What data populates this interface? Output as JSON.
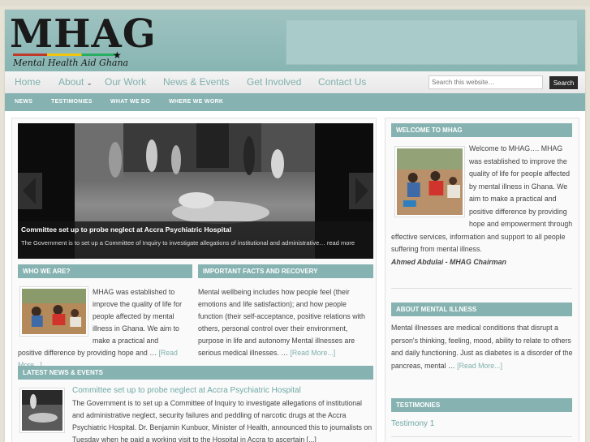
{
  "brand": {
    "name": "MHAG",
    "tagline": "Mental Health Aid Ghana",
    "stripe_colors": [
      "#c0392b",
      "#f1c40f",
      "#27ae60"
    ]
  },
  "colors": {
    "accent": "#86b3b1",
    "link": "#7fb0ad",
    "header": "#9fc3c1"
  },
  "nav": {
    "items": [
      {
        "label": "Home"
      },
      {
        "label": "About",
        "dropdown": true
      },
      {
        "label": "Our Work"
      },
      {
        "label": "News & Events"
      },
      {
        "label": "Get Involved"
      },
      {
        "label": "Contact Us"
      }
    ],
    "chevron": "⌄"
  },
  "search": {
    "placeholder": "Search this website…",
    "button_label": "Search"
  },
  "subnav": {
    "items": [
      "NEWS",
      "TESTIMONIES",
      "WHAT WE DO",
      "WHERE WE WORK"
    ]
  },
  "slider": {
    "title": "Committee set up to probe neglect at Accra Psychiatric Hospital",
    "description": "The Government is to set up a Committee of Inquiry to investigate allegations of institutional and administrative… read more",
    "prev_icon": "chevron-left-icon",
    "next_icon": "chevron-right-icon"
  },
  "who_we_are": {
    "heading": "WHO WE ARE?",
    "text": "MHAG was established to improve the quality of life for people affected by mental illness in Ghana. We aim to make a practical and positive difference by providing hope and … ",
    "read_more": "[Read More...]"
  },
  "facts": {
    "heading": "IMPORTANT FACTS AND RECOVERY",
    "text": "Mental wellbeing includes how people feel (their emotions and life satisfaction); and how people function (their self-acceptance, positive relations with others, personal control over their environment, purpose in life and autonomy Mental illnesses are serious medical illnesses. … ",
    "read_more": "[Read More...]"
  },
  "latest_news": {
    "heading": "LATEST NEWS & EVENTS",
    "title": "Committee set up to probe neglect at Accra Psychiatric Hospital",
    "text": "The Government is to set up a Committee of Inquiry to investigate allegations of institutional and administrative neglect, security failures and peddling of narcotic drugs at the Accra Psychiatric Hospital. Dr. Benjamin Kunbuor, Minister of Health, announced this to journalists on Tuesday when he paid a working visit to the Hospital in Accra to ascertain [...]"
  },
  "welcome": {
    "heading": "WELCOME TO MHAG",
    "text": "Welcome to MHAG…. MHAG was established to improve the quality of life for people affected by mental illness in Ghana. We aim to make a practical and positive difference by providing hope and empowerment through effective services, information and support to all people suffering from mental illness.",
    "signature": "Ahmed Abdulai - MHAG Chairman"
  },
  "about_illness": {
    "heading": "ABOUT MENTAL ILLNESS",
    "text": "Mental illnesses are medical conditions that disrupt a person's thinking, feeling, mood, ability to relate to others and daily functioning. Just as diabetes is a disorder of the pancreas, mental … ",
    "read_more": "[Read More...]"
  },
  "testimonies": {
    "heading": "TESTIMONIES",
    "items": [
      "Testimony 1"
    ]
  }
}
